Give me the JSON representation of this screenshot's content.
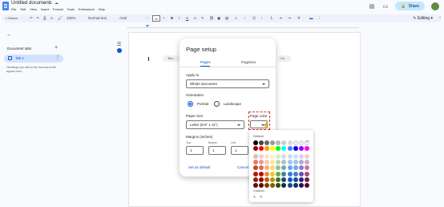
{
  "app": {
    "doc_title": "Untitled document",
    "title_icons": "☆ ⧉ ☁",
    "menu": [
      "File",
      "Edit",
      "View",
      "Insert",
      "Format",
      "Tools",
      "Extensions",
      "Help"
    ],
    "share_label": "Share",
    "editing_mode": "Editing"
  },
  "toolbar": {
    "search_label": "Menus",
    "zoom": "100%",
    "style": "Normal text",
    "font": "Arial",
    "font_size": "11"
  },
  "sidebar": {
    "title": "Document tabs",
    "tab_label": "Tab 1",
    "hint": "Headings you add to the document will appear here."
  },
  "page": {
    "chip_left": "Tem",
    "chip_right": "Cu"
  },
  "dialog": {
    "title": "Page setup",
    "tabs": [
      "Pages",
      "Pageless"
    ],
    "apply_to_label": "Apply to",
    "apply_to_value": "Whole document",
    "orientation_label": "Orientation",
    "portrait": "Portrait",
    "landscape": "Landscape",
    "paper_size_label": "Paper size",
    "paper_size_value": "Letter (8.5\" x 11\")",
    "page_color_label": "Page color",
    "margins_label": "Margins (inches)",
    "margins": [
      {
        "label": "Top",
        "value": "1"
      },
      {
        "label": "Bottom",
        "value": "1"
      },
      {
        "label": "Left",
        "value": "1"
      }
    ],
    "set_default": "Set as default",
    "cancel": "Cancel"
  },
  "palette": {
    "default_label": "Default",
    "custom_label": "Custom",
    "custom_add": "+",
    "rows": [
      [
        "#000000",
        "#434343",
        "#666666",
        "#999999",
        "#b7b7b7",
        "#cccccc",
        "#d9d9d9",
        "#efefef",
        "#f3f3f3",
        "#ffffff"
      ],
      [
        "#980000",
        "#ff0000",
        "#ff9900",
        "#ffff00",
        "#00ff00",
        "#00ffff",
        "#4a86e8",
        "#0000ff",
        "#9900ff",
        "#ff00ff"
      ],
      [
        "#e6b8af",
        "#f4cccc",
        "#fce5cd",
        "#fff2cc",
        "#d9ead3",
        "#d0e0e3",
        "#c9daf8",
        "#cfe2f3",
        "#d9d2e9",
        "#ead1dc"
      ],
      [
        "#dd7e6b",
        "#ea9999",
        "#f9cb9c",
        "#ffe599",
        "#b6d7a8",
        "#a2c4c9",
        "#a4c2f4",
        "#9fc5e8",
        "#b4a7d6",
        "#d5a6bd"
      ],
      [
        "#cc4125",
        "#e06666",
        "#f6b26b",
        "#ffd966",
        "#93c47d",
        "#76a5af",
        "#6d9eeb",
        "#6fa8dc",
        "#8e7cc3",
        "#c27ba0"
      ],
      [
        "#a61c00",
        "#cc0000",
        "#e69138",
        "#f1c232",
        "#6aa84f",
        "#45818e",
        "#3c78d8",
        "#3d85c6",
        "#674ea7",
        "#a64d79"
      ],
      [
        "#85200c",
        "#990000",
        "#b45f06",
        "#bf9000",
        "#38761d",
        "#134f5c",
        "#1155cc",
        "#0b5394",
        "#351c75",
        "#741b47"
      ],
      [
        "#5b0f00",
        "#660000",
        "#783f04",
        "#7f6000",
        "#274e13",
        "#0c343d",
        "#1c4587",
        "#073763",
        "#20124d",
        "#4c1130"
      ]
    ],
    "selected": "#ffffff"
  }
}
